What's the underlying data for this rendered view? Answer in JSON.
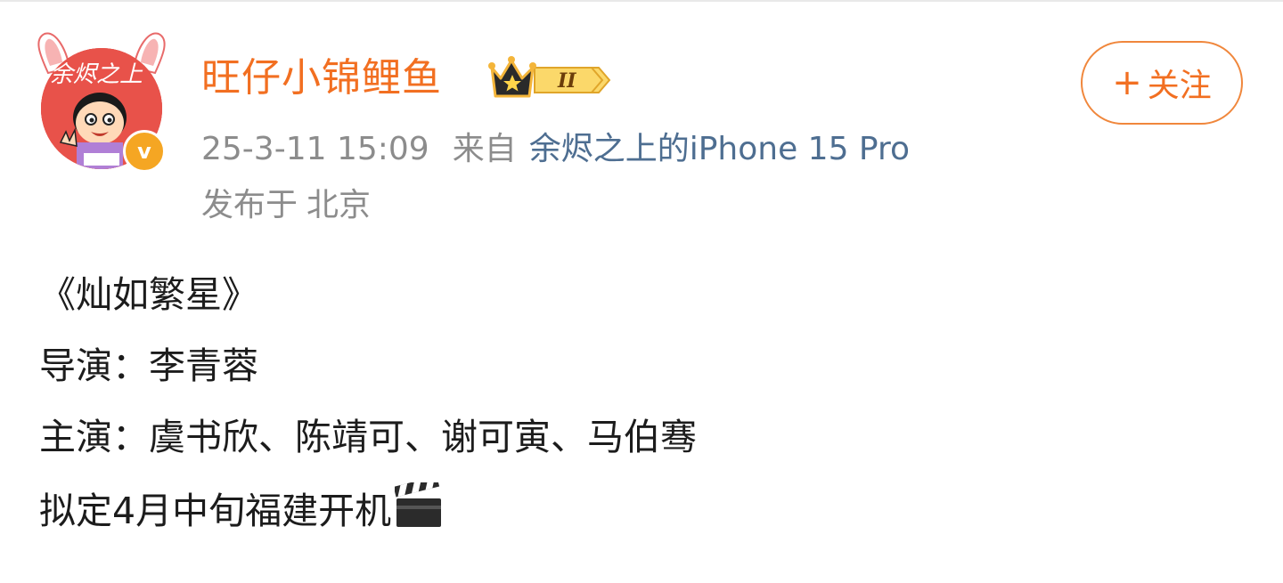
{
  "post": {
    "author": {
      "name": "旺仔小锦鲤鱼",
      "avatar_caption": "余烬之上",
      "level_badge": "II",
      "verified_icon": "v-verified-icon"
    },
    "follow_button": {
      "icon": "plus-icon",
      "label": "关注"
    },
    "meta": {
      "timestamp": "25-3-11 15:09",
      "source_prefix": "来自",
      "device": "余烬之上的iPhone 15 Pro",
      "location_prefix": "发布于",
      "location": "北京"
    },
    "content": {
      "title_line": "《灿如繁星》",
      "director_line": "导演：李青蓉",
      "cast_line": "主演：虞书欣、陈靖可、谢可寅、马伯骞",
      "schedule_line": "拟定4月中旬福建开机",
      "schedule_icon": "clapper-board-icon"
    },
    "colors": {
      "username": "#f26f21",
      "meta_text": "#8c8c8c",
      "device_link": "#4e6e91",
      "follow_border": "#f0873c",
      "body_text": "#1c1c1c"
    }
  }
}
